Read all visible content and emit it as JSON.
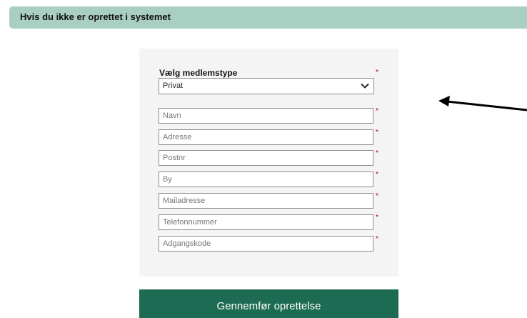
{
  "section": {
    "title": "Hvis du ikke er oprettet i systemet"
  },
  "form": {
    "member_type_label": "Vælg medlemstype",
    "member_type_value": "Privat",
    "required_marker": "*",
    "fields": [
      {
        "placeholder": "Navn"
      },
      {
        "placeholder": "Adresse"
      },
      {
        "placeholder": "Postnr"
      },
      {
        "placeholder": "By"
      },
      {
        "placeholder": "Mailadresse"
      },
      {
        "placeholder": "Telefonnummer"
      },
      {
        "placeholder": "Adgangskode"
      }
    ],
    "submit_label": "Gennemfør oprettelse"
  },
  "icons": {
    "select_chevron": "chevron-down-icon",
    "annotation": "arrow-left-icon"
  },
  "colors": {
    "header_bg": "#a9cfc2",
    "panel_bg": "#f4f4f4",
    "button_bg": "#1d6b52",
    "required": "#b00020"
  }
}
